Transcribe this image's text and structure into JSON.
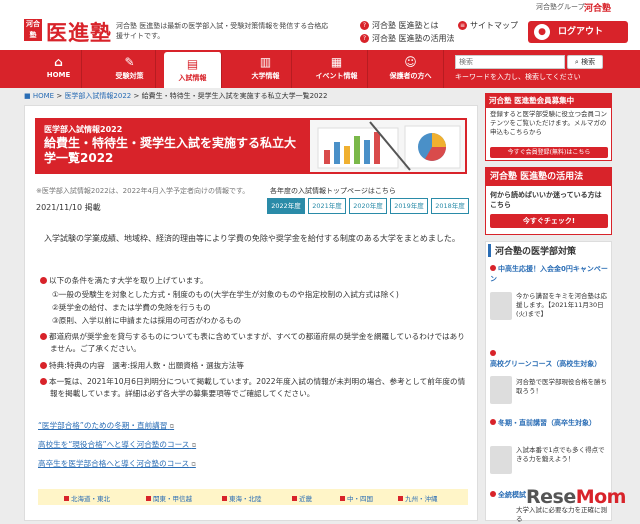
{
  "header": {
    "logo_badge": "河合塾",
    "logo_text": "医進塾",
    "description": "河合塾 医進塾は最新の医学部入試・受験対策情報を発信する合格応援サイトです。",
    "group_label": "河合塾グループ",
    "group_name": "河合塾",
    "links": [
      "河合塾 医進塾とは",
      "河合塾 医進塾の活用法",
      "サイトマップ"
    ],
    "login_label": "ログアウト"
  },
  "nav": {
    "items": [
      {
        "label": "HOME",
        "icon": "home-icon"
      },
      {
        "label": "受験対策",
        "icon": "pencil-icon"
      },
      {
        "label": "入試情報",
        "icon": "document-icon"
      },
      {
        "label": "大学情報",
        "icon": "building-icon"
      },
      {
        "label": "イベント情報",
        "icon": "calendar-icon"
      },
      {
        "label": "保護者の方へ",
        "icon": "people-icon"
      }
    ],
    "active_index": 2,
    "search_placeholder": "検索",
    "search_button": "検索",
    "search_hint": "キーワードを入力し、検索してください"
  },
  "breadcrumb": [
    "HOME",
    "医学部入試情報2022",
    "給費生・特待生・奨学生入試を実施する私立大学一覧2022"
  ],
  "banner": {
    "category": "医学部入試情報2022",
    "title": "給費生・特待生・奨学生入試を実施する私立大学一覧2022"
  },
  "meta": {
    "note": "※医学部入試情報2022は、2022年4月入学予定者向けの情報です。",
    "archive_label": "各年度の入試情報トップページはこちら",
    "date": "2021/11/10 掲載",
    "year_tabs": [
      "2022年度",
      "2021年度",
      "2020年度",
      "2019年度",
      "2018年度"
    ],
    "active_year": 0
  },
  "content": {
    "intro": "入学試験の学業成績、地域枠、経済的理由等により学費の免除や奨学金を給付する制度のある大学をまとめました。",
    "bullet1": "以下の条件を満たす大学を取り上げています。",
    "conditions": [
      "①一般の受験生を対象とした方式・制度のもの(大学在学生が対象のものや指定校制の入試方式は除く)",
      "②奨学金の給付、または学費の免除を行うもの",
      "③原則、入学以前に申請または採用の可否がわかるもの"
    ],
    "bullet2": "都道府県が奨学金を貸与するものについても表に含めていますが、すべての都道府県の奨学金を網羅しているわけではありません。ご了承ください。",
    "bullet3": "特典:特典の内容　選考:採用人数・出願資格・選抜方法等",
    "bullet4": "本一覧は、2021年10月6日判明分について掲載しています。2022年度入試の情報が未判明の場合、参考として前年度の情報を掲載しています。詳細は必ず各大学の募集要項等でご確認してください。",
    "links": [
      "“医学部合格”のための冬期・直前講習",
      "高校生を“現役合格”へと導く河合塾のコース",
      "高卒生を医学部合格へと導く河合塾のコース"
    ],
    "regions": [
      "北海道・東北",
      "関東・甲信越",
      "東海・北陸",
      "近畿",
      "中・四国",
      "九州・沖縄"
    ]
  },
  "sidebar": {
    "promo1": {
      "head": "河合塾 医進塾会員募集中",
      "body": "登録すると医学部受験に役立つ会員コンテンツをご覧いただけます。メルマガの申込もこちらから",
      "button": "今すぐ会員登録(無料)はこちら"
    },
    "promo2": {
      "head": "河合塾 医進塾の活用法",
      "body": "何から読めばいいか迷っている方はこちら",
      "button": "今すぐチェック!"
    },
    "panel_title": "河合塾の医学部対策",
    "items": [
      {
        "title": "中高生応援！入会金0円キャンペーン",
        "text": "今から講習をキミを河合塾は応援します。【2021年11月30日(火)まで】"
      },
      {
        "title": "高校グリーンコース（高校生対象）",
        "text": "河合塾で医学部現役合格を勝ち取ろう！"
      },
      {
        "title": "冬期・直前講習（高卒生対象）",
        "text": "入試本番で1点でも多く得点できる力を鍛えよう！"
      },
      {
        "title": "全統模試",
        "text": "大学入試に必要な力を正確に測る"
      }
    ]
  },
  "watermark": {
    "a": "Rese",
    "b": "Mom"
  }
}
